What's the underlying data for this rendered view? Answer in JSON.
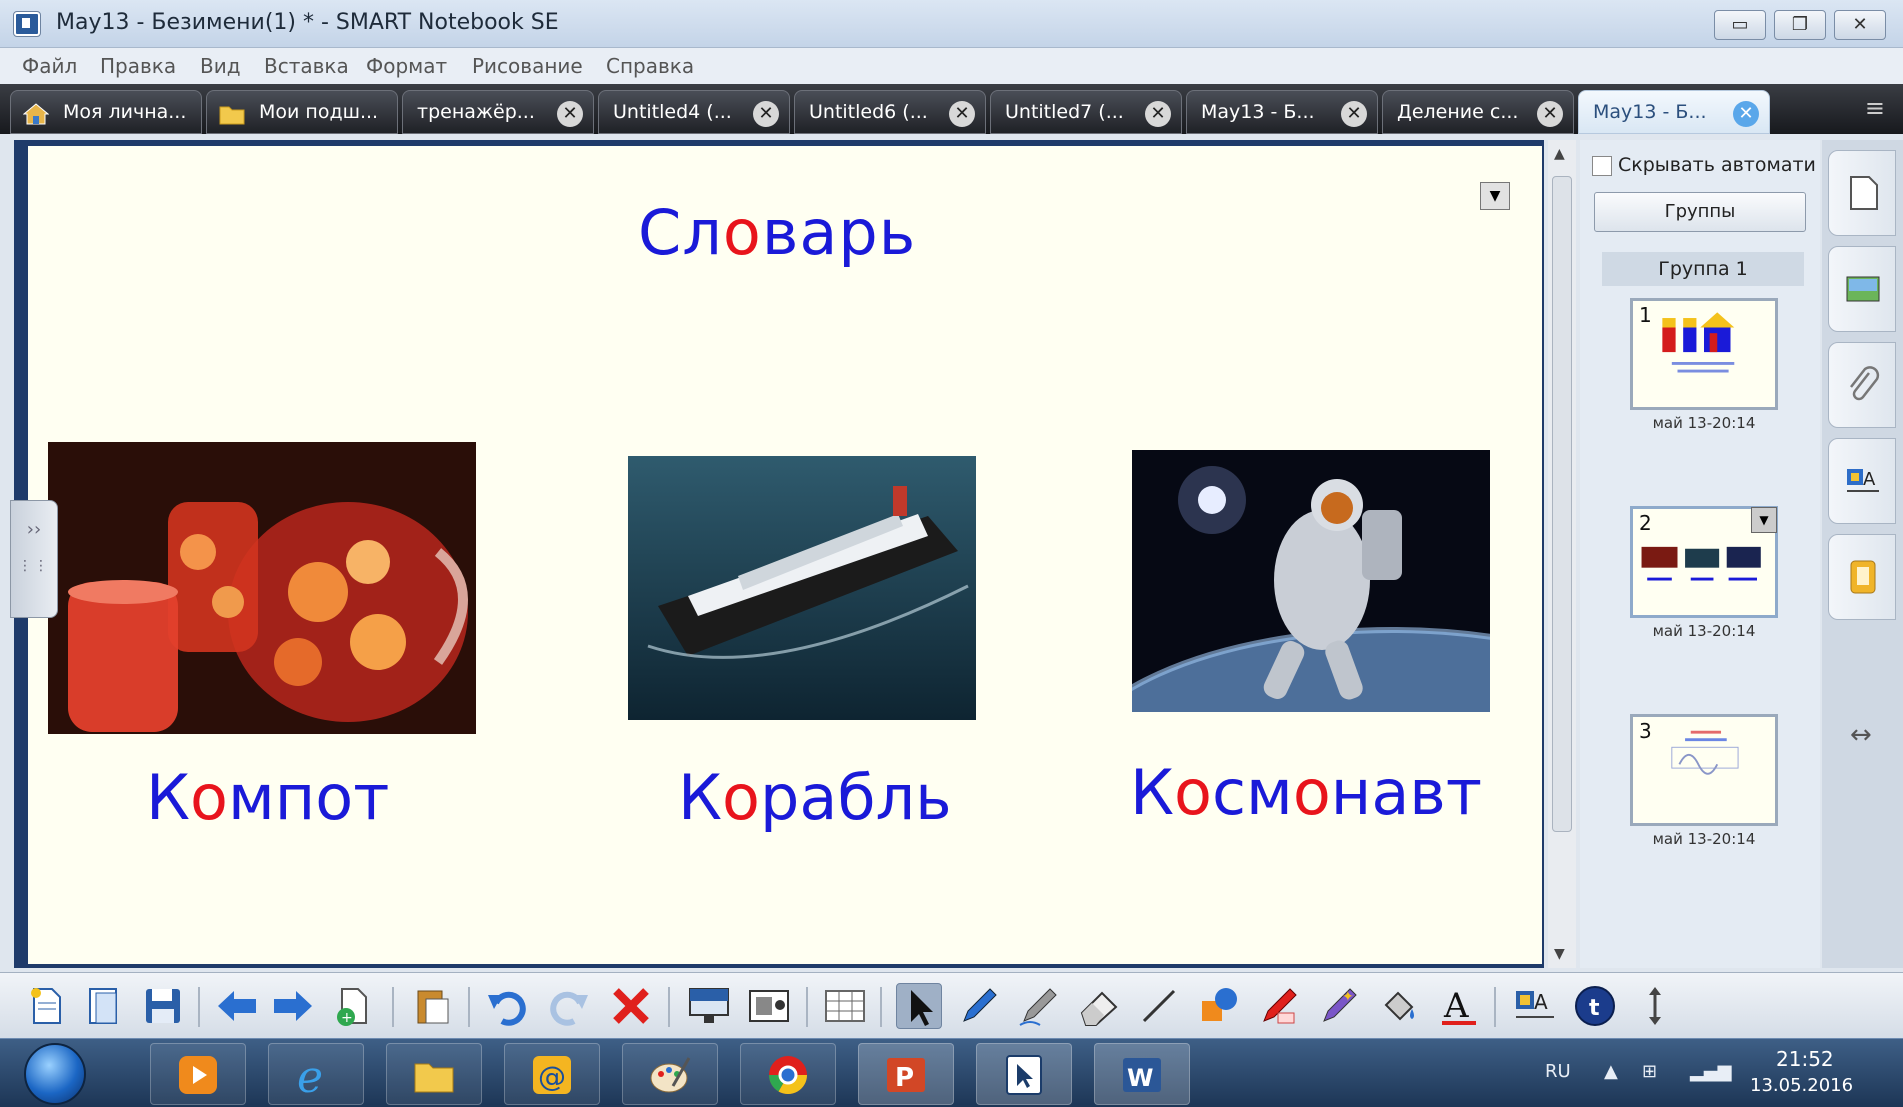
{
  "window": {
    "title": "May13 - Безимени(1) * - SMART Notebook SE",
    "minimize": "▭",
    "restore": "❐",
    "close": "✕"
  },
  "menu": [
    "Файл",
    "Правка",
    "Вид",
    "Вставка",
    "Формат",
    "Рисование",
    "Справка"
  ],
  "tabs": [
    {
      "label": "Моя лична...",
      "icon": "home-icon"
    },
    {
      "label": "Мои подш...",
      "icon": "folder-icon"
    },
    {
      "label": "тренажёр..."
    },
    {
      "label": "Untitled4 (..."
    },
    {
      "label": "Untitled6 (..."
    },
    {
      "label": "Untitled7 (..."
    },
    {
      "label": "May13 - Б..."
    },
    {
      "label": "Деление с..."
    },
    {
      "label": "May13 - Б...",
      "active": true
    }
  ],
  "tab_close_glyph": "✕",
  "canvas": {
    "title_parts": [
      "Сл",
      "о",
      "варь"
    ],
    "words": [
      {
        "parts": [
          "К",
          "о",
          "мпот"
        ]
      },
      {
        "parts": [
          "К",
          "о",
          "рабль"
        ]
      },
      {
        "parts": [
          "К",
          "о",
          "см",
          "о",
          "навт"
        ]
      }
    ],
    "dropdown_glyph": "▼",
    "side_handle_glyph": "››"
  },
  "sorter": {
    "autohide_label": "Скрывать автомати",
    "groups_button": "Группы",
    "group_header": "Группа 1",
    "pages": [
      {
        "number": "1",
        "date": "май 13-20:14"
      },
      {
        "number": "2",
        "date": "май 13-20:14"
      },
      {
        "number": "3",
        "date": "май 13-20:14"
      }
    ]
  },
  "right_tabs": [
    "page-sorter-icon",
    "gallery-icon",
    "attachments-icon",
    "properties-icon",
    "addons-icon"
  ],
  "toolbar_icons": [
    "new-page-icon",
    "pages-icon",
    "save-icon",
    "back-arrow-icon",
    "forward-arrow-icon",
    "add-page-icon",
    "paste-icon",
    "undo-icon",
    "redo-icon",
    "delete-icon",
    "screen-shade-icon",
    "screen-capture-icon",
    "table-icon",
    "select-icon",
    "pen-icon",
    "creative-pen-icon",
    "eraser-icon",
    "line-icon",
    "shapes-icon",
    "magic-pen-icon",
    "highlighter-icon",
    "fill-icon",
    "text-icon",
    "properties-icon",
    "smart-response-icon",
    "move-toolbar-icon"
  ],
  "taskbar": {
    "apps": [
      "media-player-icon",
      "internet-explorer-icon",
      "file-explorer-icon",
      "mail-agent-icon",
      "paint-icon",
      "chrome-icon",
      "powerpoint-icon",
      "smart-notebook-icon",
      "word-icon"
    ],
    "language": "RU",
    "time": "21:52",
    "date": "13.05.2016"
  },
  "colors": {
    "word_blue": "#1a1ad8",
    "highlight_red": "#e8141c",
    "canvas_bg": "#fffff2"
  }
}
